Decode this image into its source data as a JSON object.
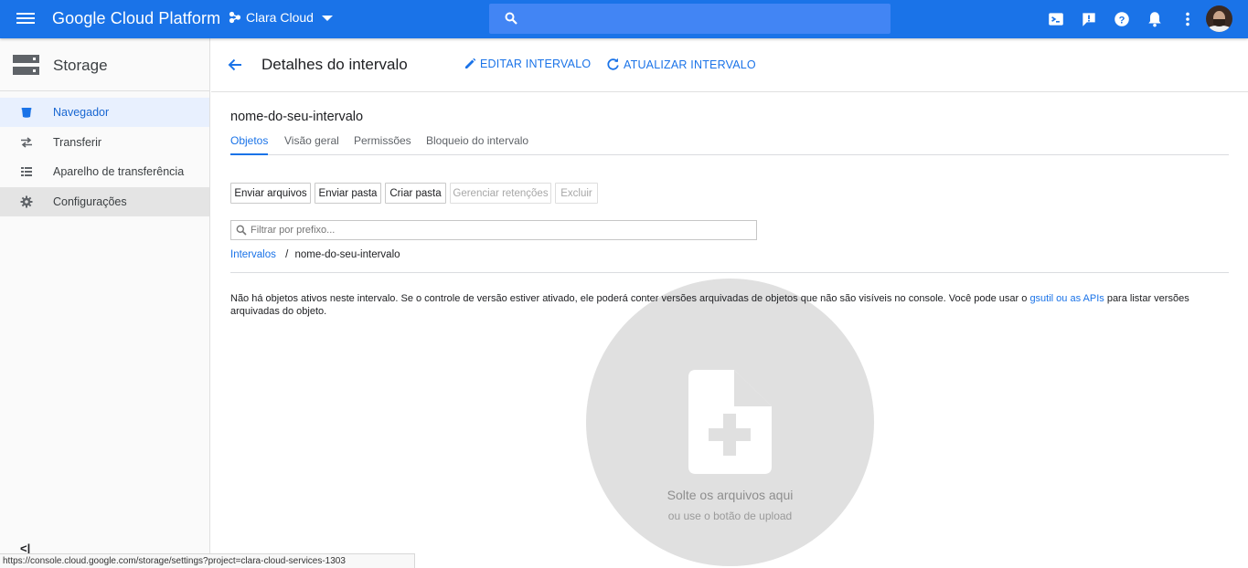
{
  "topbar": {
    "brand": "Google Cloud Platform",
    "project": "Clara Cloud",
    "search_placeholder": "",
    "icons": [
      "cloud-shell-icon",
      "feedback-icon",
      "help-icon",
      "notifications-icon",
      "more-vert-icon"
    ],
    "accent": "#1a73e8"
  },
  "sidebar": {
    "title": "Storage",
    "items": [
      {
        "label": "Navegador",
        "icon": "bucket-icon",
        "state": "active"
      },
      {
        "label": "Transferir",
        "icon": "transfer-icon",
        "state": ""
      },
      {
        "label": "Aparelho de transferência",
        "icon": "appliance-icon",
        "state": ""
      },
      {
        "label": "Configurações",
        "icon": "gear-icon",
        "state": "hover"
      }
    ],
    "collapse_label": "<|"
  },
  "header": {
    "title": "Detalhes do intervalo",
    "edit_label": "EDITAR INTERVALO",
    "refresh_label": "ATUALIZAR INTERVALO"
  },
  "bucket": {
    "name": "nome-do-seu-intervalo",
    "tabs": [
      "Objetos",
      "Visão geral",
      "Permissões",
      "Bloqueio do intervalo"
    ],
    "active_tab": "Objetos"
  },
  "actions": {
    "upload_files": "Enviar arquivos",
    "upload_folder": "Enviar pasta",
    "create_folder": "Criar pasta",
    "manage_holds": "Gerenciar retenções",
    "delete": "Excluir"
  },
  "filter": {
    "placeholder": "Filtrar por prefixo...",
    "value": ""
  },
  "breadcrumb": {
    "root": "Intervalos",
    "separator": "/",
    "current": "nome-do-seu-intervalo"
  },
  "message": {
    "before": "Não há objetos ativos neste intervalo. Se o controle de versão estiver ativado, ele poderá conter versões arquivadas de objetos que não são visíveis no console. Você pode usar o ",
    "link": "gsutil ou as APIs",
    "after": " para listar versões arquivadas do objeto."
  },
  "dropzone": {
    "line1": "Solte os arquivos aqui",
    "line2": "ou use o botão de upload"
  },
  "status_url": "https://console.cloud.google.com/storage/settings?project=clara-cloud-services-1303"
}
